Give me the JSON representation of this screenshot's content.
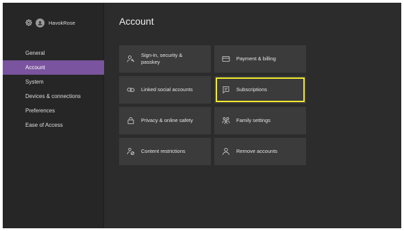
{
  "profile": {
    "username": "HavokRose",
    "settings_icon": "gear-icon",
    "avatar_icon": "avatar-icon"
  },
  "sidebar": {
    "items": [
      {
        "label": "General",
        "active": false
      },
      {
        "label": "Account",
        "active": true
      },
      {
        "label": "System",
        "active": false
      },
      {
        "label": "Devices & connections",
        "active": false
      },
      {
        "label": "Preferences",
        "active": false
      },
      {
        "label": "Ease of Access",
        "active": false
      }
    ]
  },
  "main": {
    "title": "Account",
    "tiles": [
      {
        "label": "Sign-in, security & passkey",
        "icon": "person-key-icon"
      },
      {
        "label": "Payment & billing",
        "icon": "credit-card-icon"
      },
      {
        "label": "Linked social accounts",
        "icon": "link-icon"
      },
      {
        "label": "Subscriptions",
        "icon": "document-list-icon",
        "focused": true
      },
      {
        "label": "Privacy & online safety",
        "icon": "lock-icon"
      },
      {
        "label": "Family settings",
        "icon": "family-icon"
      },
      {
        "label": "Content restrictions",
        "icon": "people-restricted-icon"
      },
      {
        "label": "Remove accounts",
        "icon": "person-icon"
      }
    ]
  },
  "colors": {
    "accent": "#7a549e",
    "focus": "#f4ec2c",
    "background": "#2c2c2c",
    "tile": "#3b3b3b"
  }
}
